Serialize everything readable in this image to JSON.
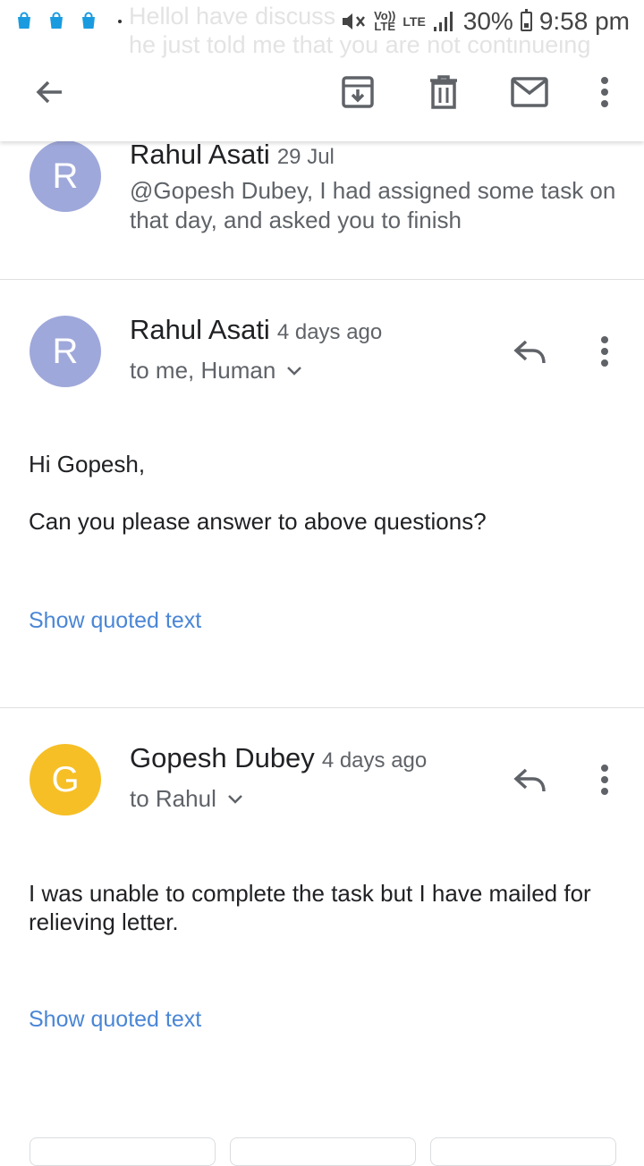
{
  "status_bar": {
    "notification_line1": "Hellol have discussed for Rahul sir and",
    "notification_line2": "he just told me that you are not continueing",
    "volte": "Vo))",
    "lte_small": "LTE",
    "lte": "LTE",
    "battery": "30%",
    "time": "9:58 pm"
  },
  "toolbar": {
    "icons": [
      "back-arrow-icon",
      "archive-icon",
      "delete-icon",
      "mark-unread-icon",
      "more-vert-icon"
    ]
  },
  "colors": {
    "avatar_r": "#9fa8da",
    "avatar_g": "#f6bf26",
    "link": "#4a86d6"
  },
  "messages": [
    {
      "avatar_letter": "R",
      "sender": "Rahul Asati",
      "date": "29 Jul",
      "snippet": "@Gopesh Dubey, I had assigned some task on that day, and asked you to finish"
    },
    {
      "avatar_letter": "R",
      "sender": "Rahul Asati",
      "date": "4 days ago",
      "recipients": "to me, Human",
      "body_line1": "Hi Gopesh,",
      "body_line2": "Can you please answer to above questions?",
      "show_quoted": "Show quoted text"
    },
    {
      "avatar_letter": "G",
      "sender": "Gopesh Dubey",
      "date": "4 days ago",
      "recipients": "to Rahul",
      "body_line1": "I was unable to complete the task but I have mailed for relieving letter.",
      "show_quoted": "Show quoted text"
    }
  ]
}
